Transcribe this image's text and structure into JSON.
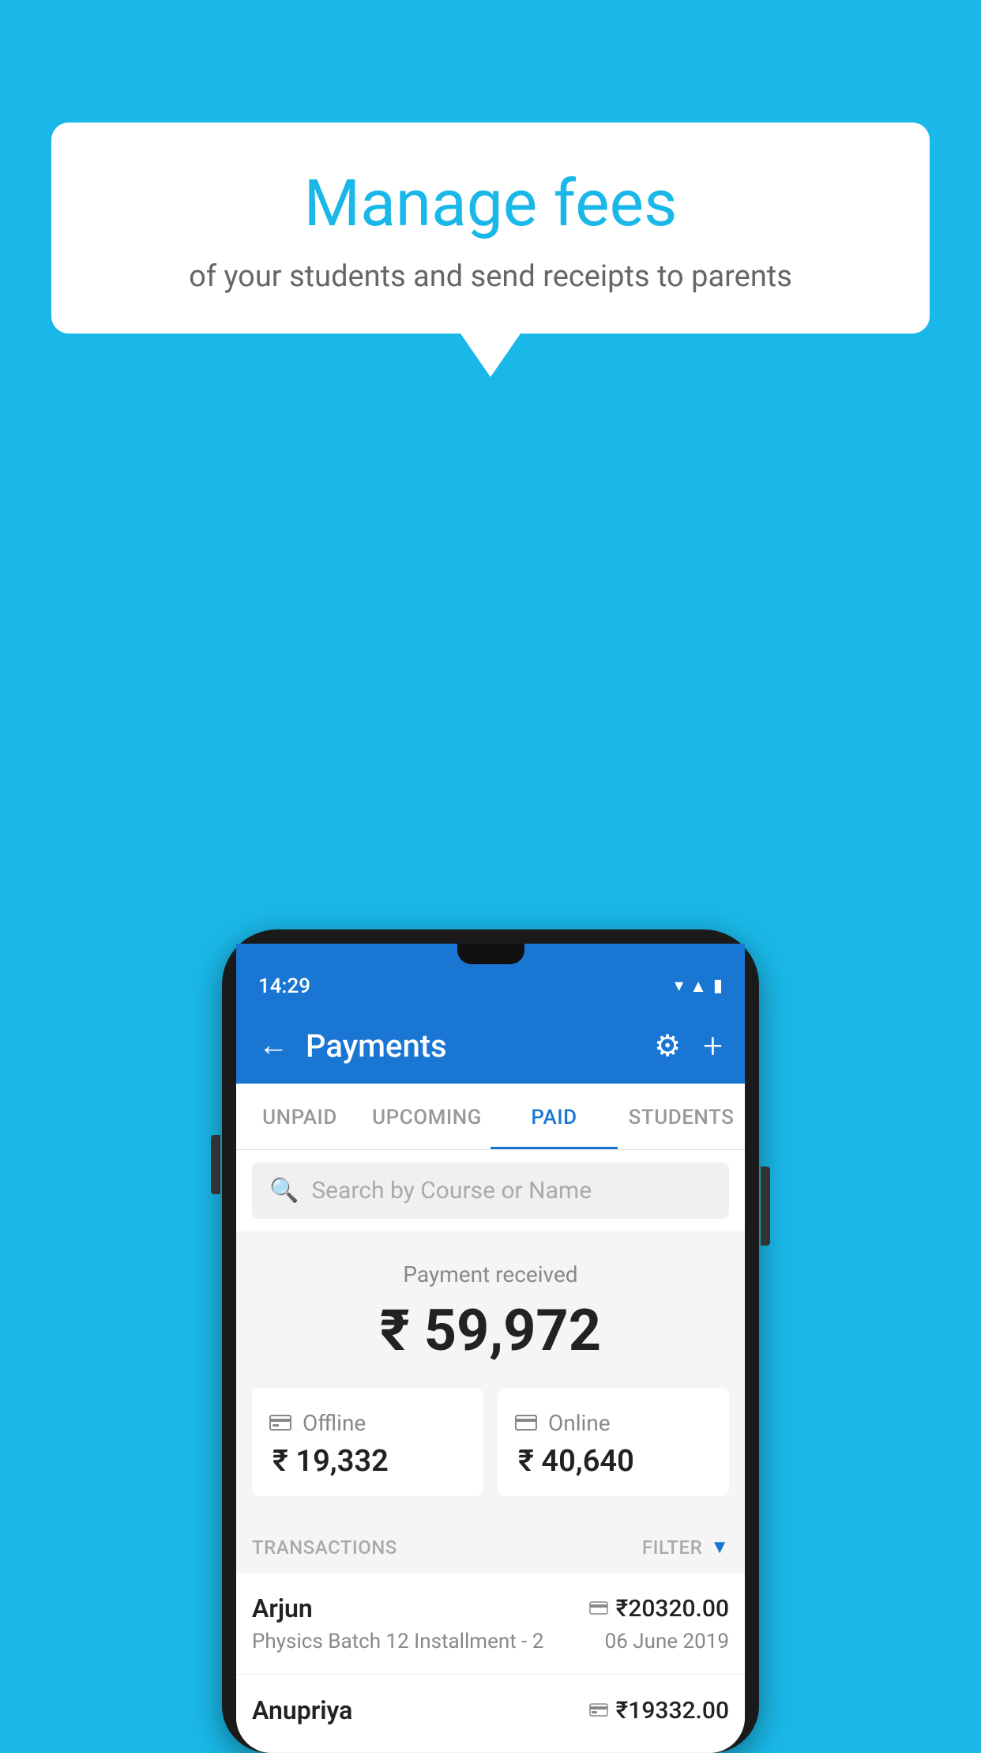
{
  "background_color": "#1ab8e8",
  "speech_bubble": {
    "title": "Manage fees",
    "subtitle": "of your students and send receipts to parents"
  },
  "phone": {
    "status_bar": {
      "time": "14:29"
    },
    "header": {
      "title": "Payments",
      "back_label": "←",
      "gear_label": "⚙",
      "plus_label": "+"
    },
    "tabs": [
      {
        "label": "UNPAID",
        "active": false
      },
      {
        "label": "UPCOMING",
        "active": false
      },
      {
        "label": "PAID",
        "active": true
      },
      {
        "label": "STUDENTS",
        "active": false
      }
    ],
    "search": {
      "placeholder": "Search by Course or Name"
    },
    "payment_summary": {
      "label": "Payment received",
      "amount": "₹ 59,972",
      "offline": {
        "label": "Offline",
        "amount": "₹ 19,332"
      },
      "online": {
        "label": "Online",
        "amount": "₹ 40,640"
      }
    },
    "transactions": {
      "label": "TRANSACTIONS",
      "filter_label": "FILTER",
      "rows": [
        {
          "name": "Arjun",
          "course": "Physics Batch 12 Installment - 2",
          "amount": "₹20320.00",
          "date": "06 June 2019",
          "payment_type": "online"
        },
        {
          "name": "Anupriya",
          "course": "",
          "amount": "₹19332.00",
          "date": "",
          "payment_type": "offline"
        }
      ]
    }
  }
}
